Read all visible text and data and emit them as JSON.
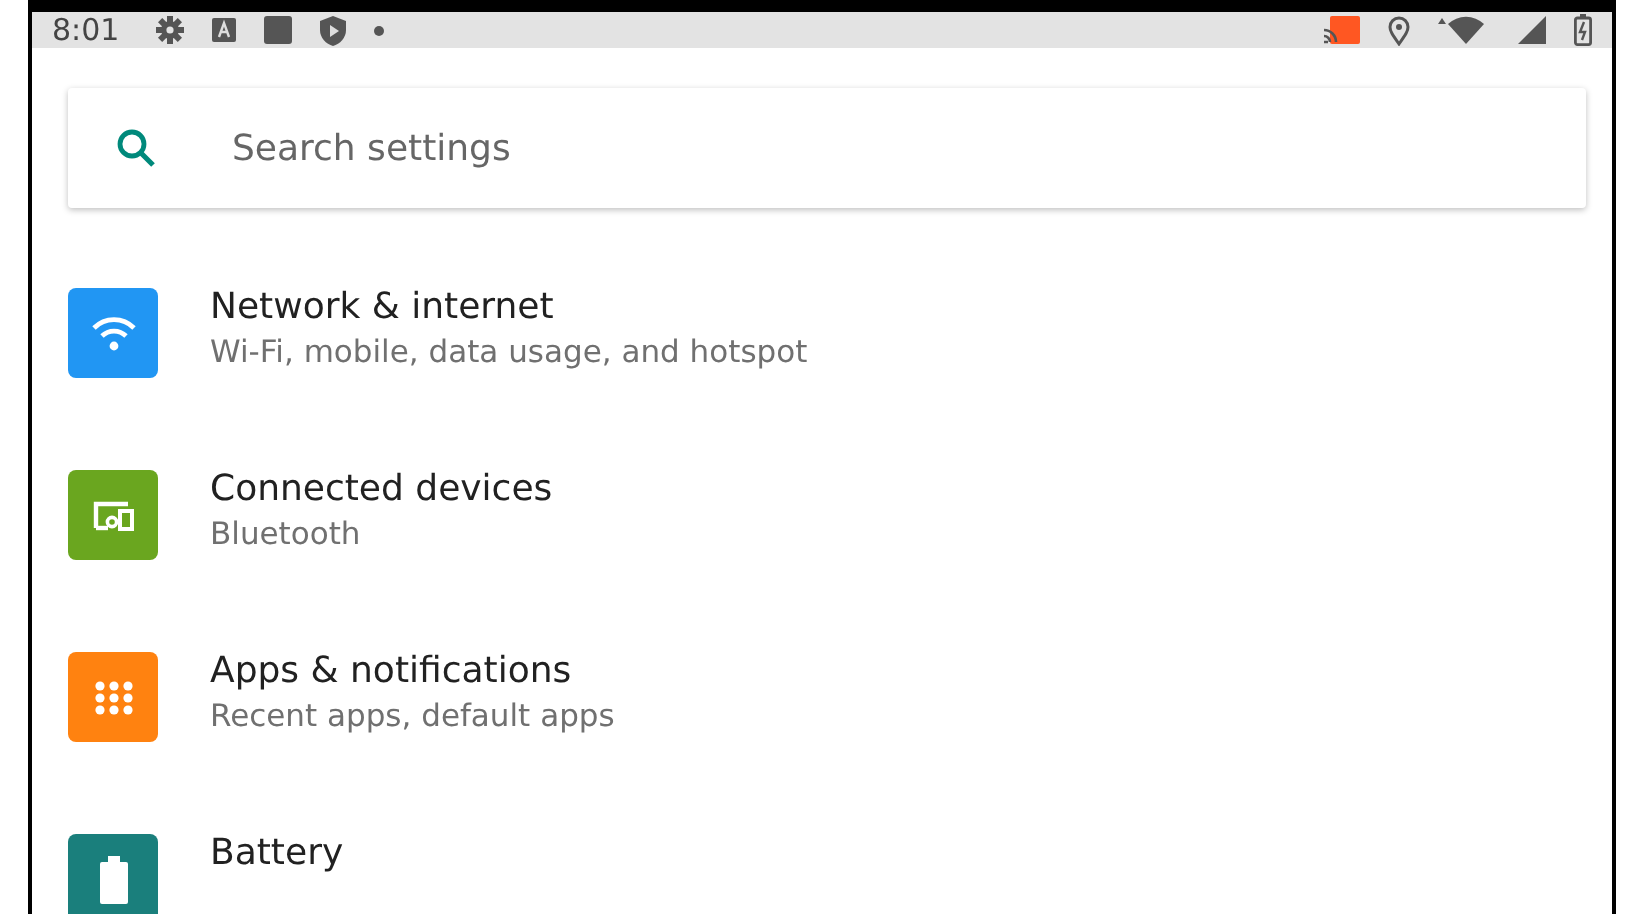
{
  "status_bar": {
    "time": "8:01"
  },
  "search": {
    "placeholder": "Search settings"
  },
  "items": [
    {
      "kind": "wifi",
      "title": "Network & internet",
      "subtitle": "Wi-Fi, mobile, data usage, and hotspot",
      "color": "#2196f3"
    },
    {
      "kind": "devices",
      "title": "Connected devices",
      "subtitle": "Bluetooth",
      "color": "#6aa61f"
    },
    {
      "kind": "apps",
      "title": "Apps & notifications",
      "subtitle": "Recent apps, default apps",
      "color": "#ff8210"
    },
    {
      "kind": "battery",
      "title": "Battery",
      "color": "#1a7f7c"
    }
  ]
}
